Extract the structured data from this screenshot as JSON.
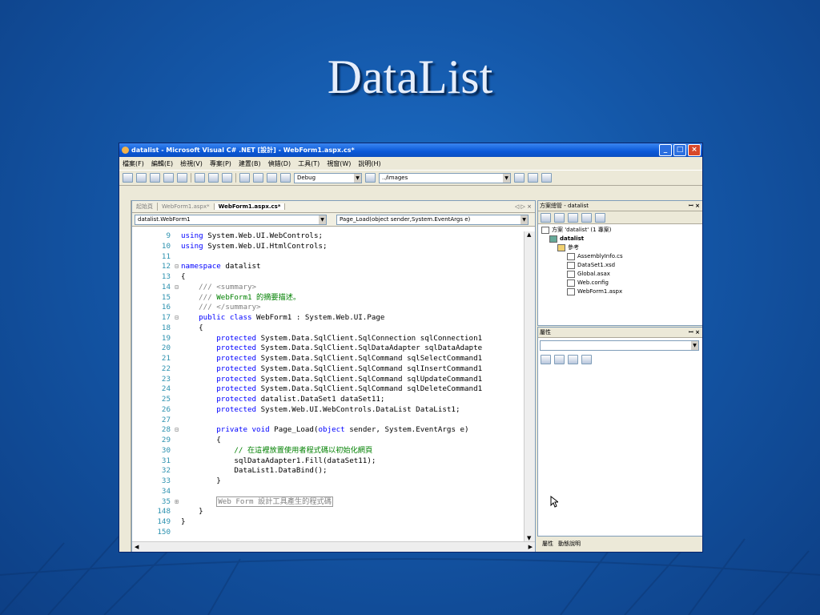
{
  "slide": {
    "title": "DataList"
  },
  "window": {
    "title": "datalist - Microsoft Visual C# .NET [設計] - WebForm1.aspx.cs*",
    "minimize": "_",
    "maximize": "□",
    "close": "×"
  },
  "menu": [
    "檔案(F)",
    "編輯(E)",
    "檢視(V)",
    "專案(P)",
    "建置(B)",
    "偵錯(D)",
    "工具(T)",
    "視窗(W)",
    "說明(H)"
  ],
  "toolbar": {
    "config": "Debug",
    "path": "../images"
  },
  "tabs": {
    "start": "起始頁",
    "design": "WebForm1.aspx*",
    "code": "WebForm1.aspx.cs*",
    "nav": "◁ ▷ ×"
  },
  "editor": {
    "class_combo": "datalist.WebForm1",
    "member_combo": "Page_Load(object sender,System.EventArgs e)"
  },
  "code_lines": [
    {
      "n": "9",
      "g": "",
      "t": [
        {
          "k": "kw",
          "v": "using"
        },
        {
          "k": "",
          "v": " System.Web.UI.WebControls;"
        }
      ]
    },
    {
      "n": "10",
      "g": "",
      "t": [
        {
          "k": "kw",
          "v": "using"
        },
        {
          "k": "",
          "v": " System.Web.UI.HtmlControls;"
        }
      ]
    },
    {
      "n": "11",
      "g": "",
      "t": [
        {
          "k": "",
          "v": ""
        }
      ]
    },
    {
      "n": "12",
      "g": "⊟",
      "t": [
        {
          "k": "kw",
          "v": "namespace"
        },
        {
          "k": "",
          "v": " datalist"
        }
      ]
    },
    {
      "n": "13",
      "g": "",
      "t": [
        {
          "k": "",
          "v": "{"
        }
      ]
    },
    {
      "n": "14",
      "g": "⊟",
      "t": [
        {
          "k": "doc",
          "v": "    /// <summary>"
        }
      ]
    },
    {
      "n": "15",
      "g": "",
      "t": [
        {
          "k": "doc",
          "v": "    /// "
        },
        {
          "k": "cm",
          "v": "WebForm1 的摘要描述。"
        }
      ]
    },
    {
      "n": "16",
      "g": "",
      "t": [
        {
          "k": "doc",
          "v": "    /// </summary>"
        }
      ]
    },
    {
      "n": "17",
      "g": "⊟",
      "t": [
        {
          "k": "kw",
          "v": "    public class"
        },
        {
          "k": "",
          "v": " WebForm1 : System.Web.UI.Page"
        }
      ]
    },
    {
      "n": "18",
      "g": "",
      "t": [
        {
          "k": "",
          "v": "    {"
        }
      ]
    },
    {
      "n": "19",
      "g": "",
      "t": [
        {
          "k": "kw",
          "v": "        protected"
        },
        {
          "k": "",
          "v": " System.Data.SqlClient.SqlConnection sqlConnection1"
        }
      ]
    },
    {
      "n": "20",
      "g": "",
      "t": [
        {
          "k": "kw",
          "v": "        protected"
        },
        {
          "k": "",
          "v": " System.Data.SqlClient.SqlDataAdapter sqlDataAdapte"
        }
      ]
    },
    {
      "n": "21",
      "g": "",
      "t": [
        {
          "k": "kw",
          "v": "        protected"
        },
        {
          "k": "",
          "v": " System.Data.SqlClient.SqlCommand sqlSelectCommand1"
        }
      ]
    },
    {
      "n": "22",
      "g": "",
      "t": [
        {
          "k": "kw",
          "v": "        protected"
        },
        {
          "k": "",
          "v": " System.Data.SqlClient.SqlCommand sqlInsertCommand1"
        }
      ]
    },
    {
      "n": "23",
      "g": "",
      "t": [
        {
          "k": "kw",
          "v": "        protected"
        },
        {
          "k": "",
          "v": " System.Data.SqlClient.SqlCommand sqlUpdateCommand1"
        }
      ]
    },
    {
      "n": "24",
      "g": "",
      "t": [
        {
          "k": "kw",
          "v": "        protected"
        },
        {
          "k": "",
          "v": " System.Data.SqlClient.SqlCommand sqlDeleteCommand1"
        }
      ]
    },
    {
      "n": "25",
      "g": "",
      "t": [
        {
          "k": "kw",
          "v": "        protected"
        },
        {
          "k": "",
          "v": " datalist.DataSet1 dataSet11;"
        }
      ]
    },
    {
      "n": "26",
      "g": "",
      "t": [
        {
          "k": "kw",
          "v": "        protected"
        },
        {
          "k": "",
          "v": " System.Web.UI.WebControls.DataList DataList1;"
        }
      ]
    },
    {
      "n": "27",
      "g": "",
      "t": [
        {
          "k": "",
          "v": ""
        }
      ]
    },
    {
      "n": "28",
      "g": "⊟",
      "t": [
        {
          "k": "kw",
          "v": "        private void"
        },
        {
          "k": "",
          "v": " Page_Load("
        },
        {
          "k": "kw",
          "v": "object"
        },
        {
          "k": "",
          "v": " sender, System.EventArgs e)"
        }
      ]
    },
    {
      "n": "29",
      "g": "",
      "t": [
        {
          "k": "",
          "v": "        {"
        }
      ]
    },
    {
      "n": "30",
      "g": "",
      "t": [
        {
          "k": "cm",
          "v": "            // 在這裡放置使用者程式碼以初始化網頁"
        }
      ]
    },
    {
      "n": "31",
      "g": "",
      "t": [
        {
          "k": "",
          "v": "            sqlDataAdapter1.Fill(dataSet11);"
        }
      ]
    },
    {
      "n": "32",
      "g": "",
      "t": [
        {
          "k": "",
          "v": "            DataList1.DataBind();"
        }
      ]
    },
    {
      "n": "33",
      "g": "",
      "t": [
        {
          "k": "",
          "v": "        }"
        }
      ]
    },
    {
      "n": "34",
      "g": "",
      "t": [
        {
          "k": "",
          "v": ""
        }
      ]
    },
    {
      "n": "35",
      "g": "⊞",
      "t": [
        {
          "k": "",
          "v": "        "
        },
        {
          "k": "rgn",
          "v": "Web Form 設計工具產生的程式碼"
        }
      ]
    },
    {
      "n": "148",
      "g": "",
      "t": [
        {
          "k": "",
          "v": "    }"
        }
      ]
    },
    {
      "n": "149",
      "g": "",
      "t": [
        {
          "k": "",
          "v": "}"
        }
      ]
    },
    {
      "n": "150",
      "g": "",
      "t": [
        {
          "k": "",
          "v": ""
        }
      ]
    }
  ],
  "solution": {
    "header": "方案總管 - datalist",
    "items": [
      "方案 'datalist' (1 專案)",
      "datalist",
      "參考",
      "AssemblyInfo.cs",
      "DataSet1.xsd",
      "Global.asax",
      "Web.config",
      "WebForm1.aspx"
    ]
  },
  "properties": {
    "header": "屬性"
  },
  "bottom_tabs": {
    "props": "屬性",
    "help": "動態說明"
  }
}
